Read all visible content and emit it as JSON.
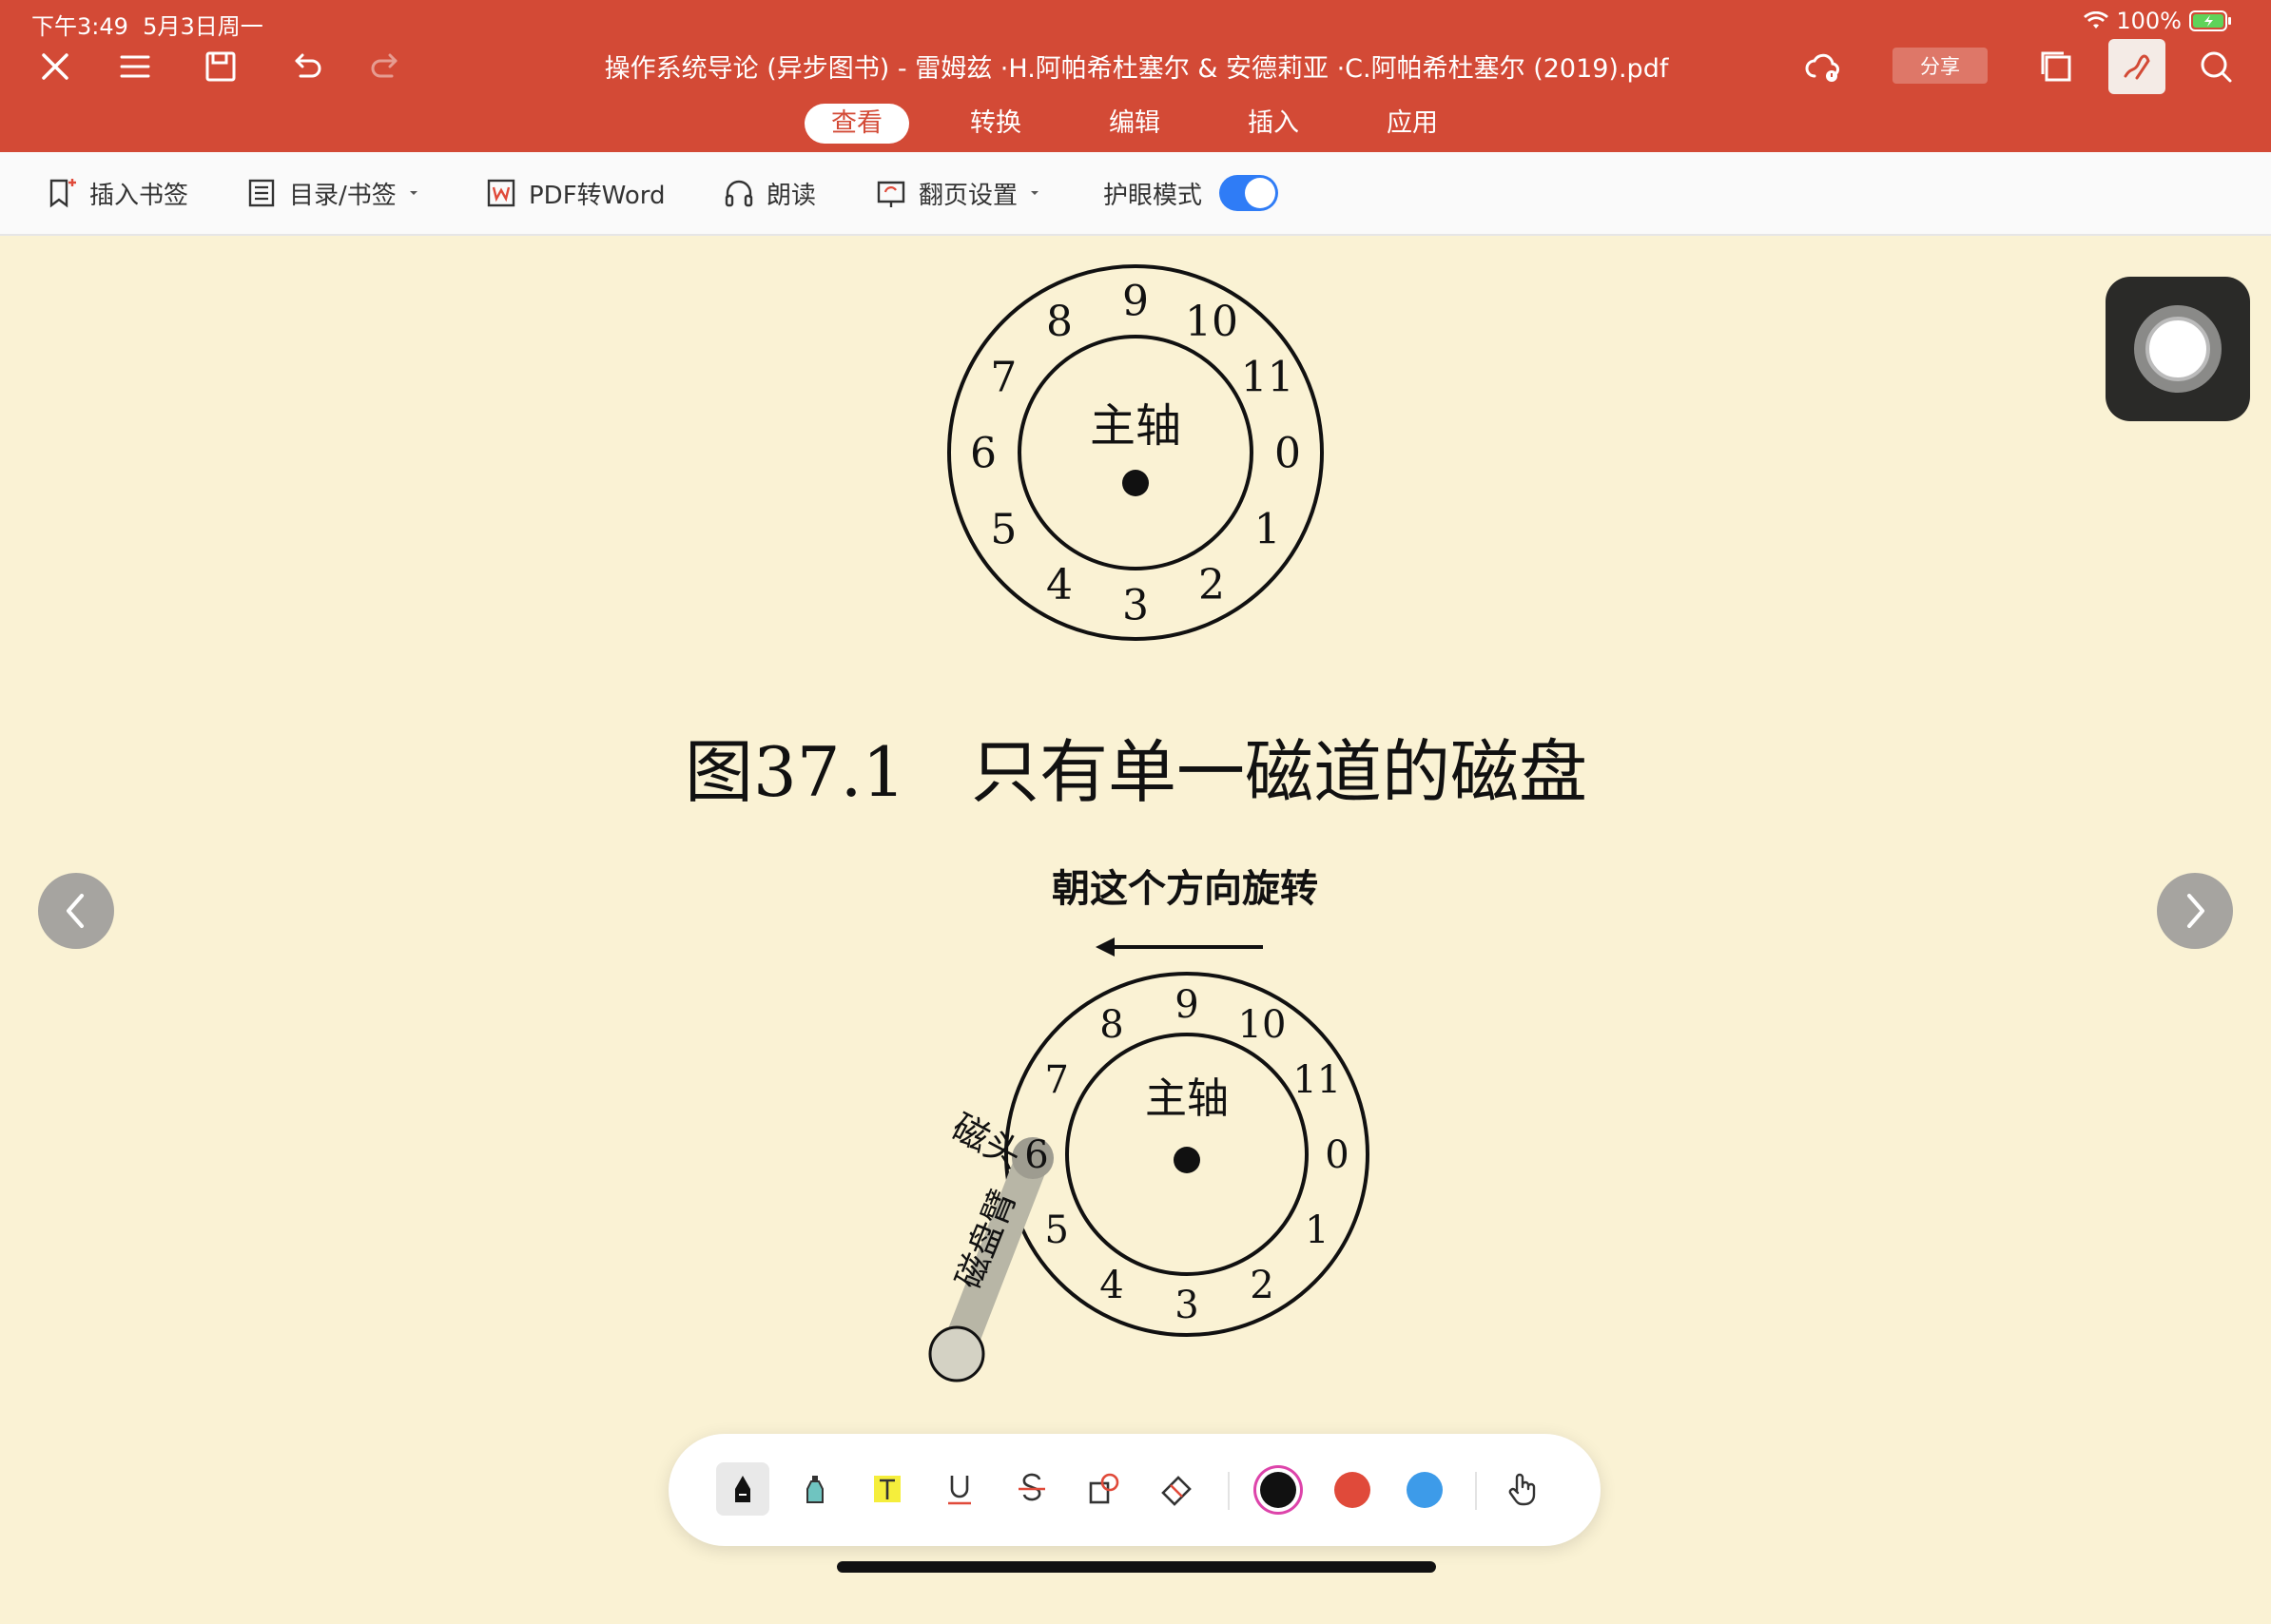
{
  "status": {
    "time": "下午3:49",
    "date": "5月3日周一",
    "battery": "100%"
  },
  "header": {
    "title": "操作系统导论 (异步图书) - 雷姆兹 ·H.阿帕希杜塞尔 & 安德莉亚 ·C.阿帕希杜塞尔 (2019).pdf",
    "share_label": "分享",
    "tabs": [
      {
        "label": "查看",
        "active": true
      },
      {
        "label": "转换",
        "active": false
      },
      {
        "label": "编辑",
        "active": false
      },
      {
        "label": "插入",
        "active": false
      },
      {
        "label": "应用",
        "active": false
      }
    ]
  },
  "toolbar": {
    "insert_bookmark": "插入书签",
    "toc_bookmark": "目录/书签",
    "pdf_to_word": "PDF转Word",
    "read_aloud": "朗读",
    "page_flip_settings": "翻页设置",
    "eye_protection": "护眼模式",
    "eye_protection_on": true
  },
  "page": {
    "figure1": {
      "spindle_label": "主轴",
      "sectors": [
        "0",
        "1",
        "2",
        "3",
        "4",
        "5",
        "6",
        "7",
        "8",
        "9",
        "10",
        "11"
      ]
    },
    "caption": "图37.1   只有单一磁道的磁盘",
    "figure2": {
      "direction_label": "朝这个方向旋转",
      "spindle_label": "主轴",
      "head_label": "磁头",
      "arm_label": "磁盘臂",
      "sectors": [
        "0",
        "1",
        "2",
        "3",
        "4",
        "5",
        "6",
        "7",
        "8",
        "9",
        "10",
        "11"
      ]
    }
  },
  "markup_tools": [
    "pen",
    "highlighter",
    "text-highlight",
    "underline",
    "strikethrough",
    "shape",
    "eraser"
  ],
  "colors": {
    "black": "#111111",
    "red": "#e04a3a",
    "blue": "#3d9be9",
    "header_red": "#d34a36",
    "page_bg": "#faf2d4"
  }
}
